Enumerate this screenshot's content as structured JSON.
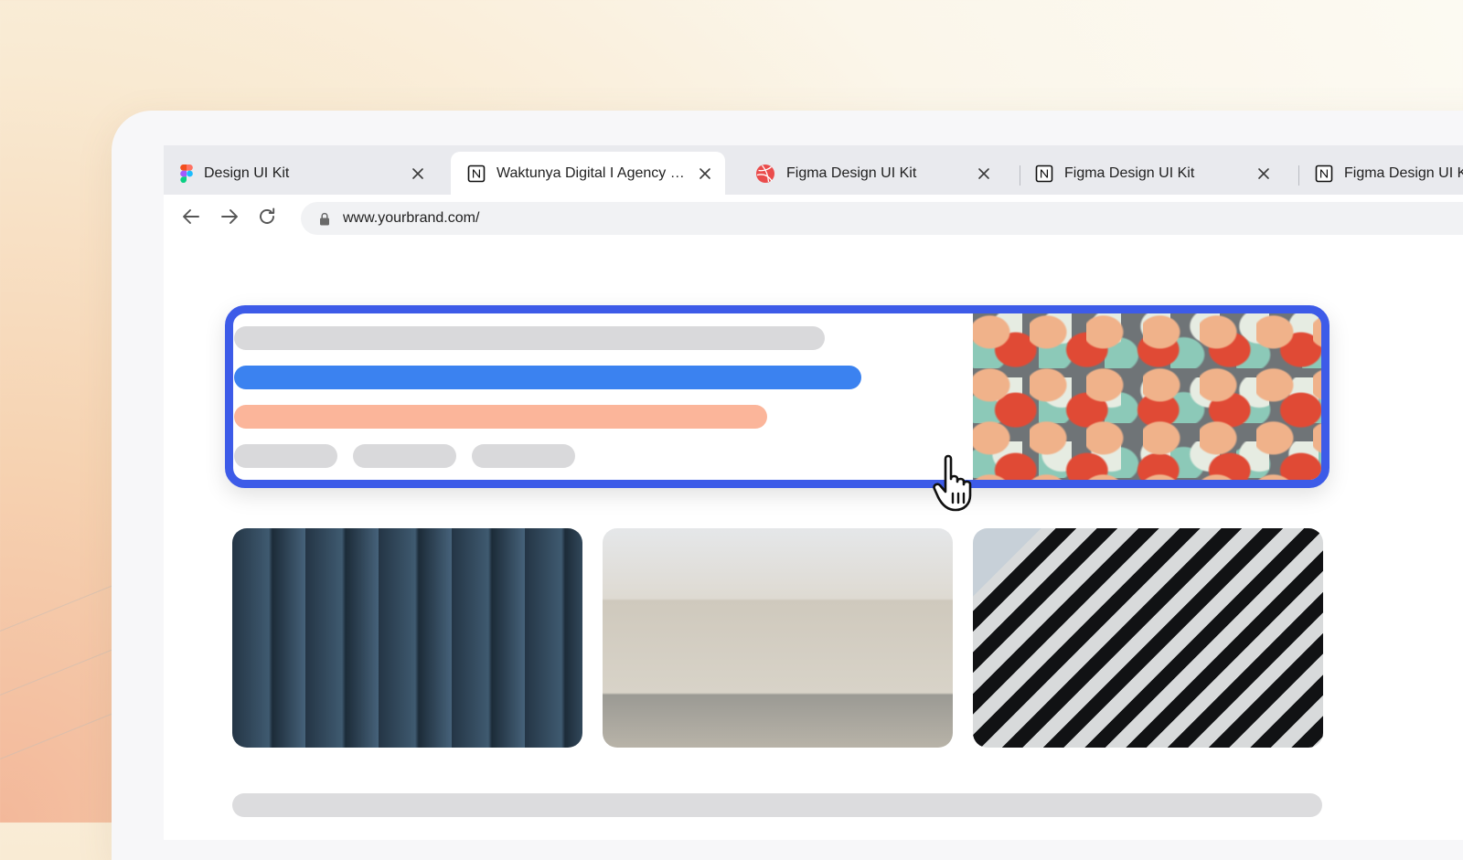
{
  "browser": {
    "tabs": [
      {
        "label": "Design UI Kit",
        "icon": "figma-icon",
        "active": false
      },
      {
        "label": "Waktunya Digital I Agency We...",
        "icon": "notion-icon",
        "active": true
      },
      {
        "label": "Figma Design UI Kit",
        "icon": "dribbble-icon",
        "active": false
      },
      {
        "label": "Figma Design UI Kit",
        "icon": "notion-icon",
        "active": false
      },
      {
        "label": "Figma Design UI Ki",
        "icon": "notion-icon",
        "active": false
      }
    ],
    "address_bar": {
      "url": "www.yourbrand.com/"
    }
  },
  "colors": {
    "highlight_border": "#3d5be8",
    "accent_blue": "#3b82f0",
    "accent_peach": "#fbb59a",
    "placeholder_gray": "#d9d9db"
  }
}
